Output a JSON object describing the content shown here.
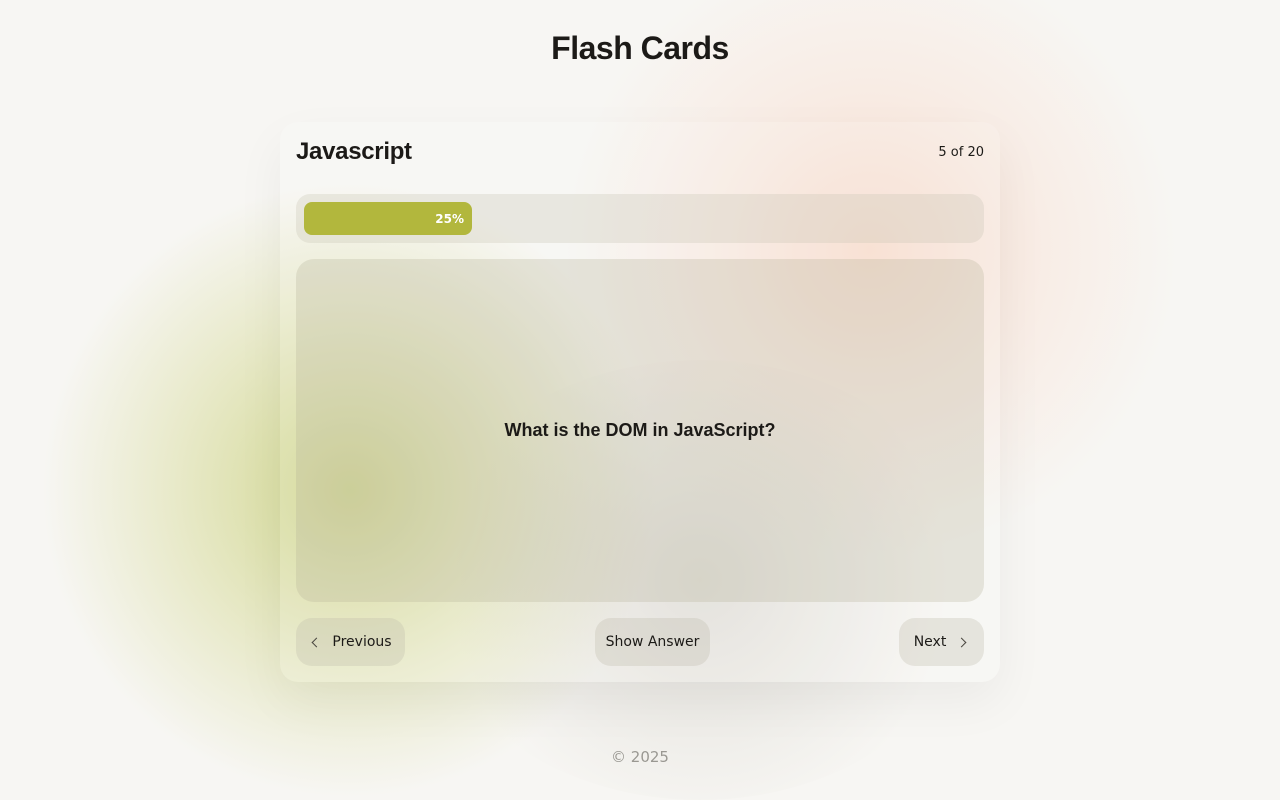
{
  "app": {
    "title": "Flash Cards"
  },
  "deck": {
    "title": "Javascript",
    "counter": "5 of 20"
  },
  "progress": {
    "label": "25%",
    "fraction": 0.25
  },
  "card": {
    "question": "What is the DOM in JavaScript?"
  },
  "controls": {
    "previous_label": "Previous",
    "show_answer_label": "Show Answer",
    "next_label": "Next"
  },
  "icons": {
    "previous": "chevron-left-icon",
    "next": "chevron-right-icon"
  },
  "colors": {
    "accent": "#b2b73d",
    "text": "#1c1a17",
    "muted": "#9a9892"
  },
  "footer": {
    "copyright": "© 2025"
  }
}
